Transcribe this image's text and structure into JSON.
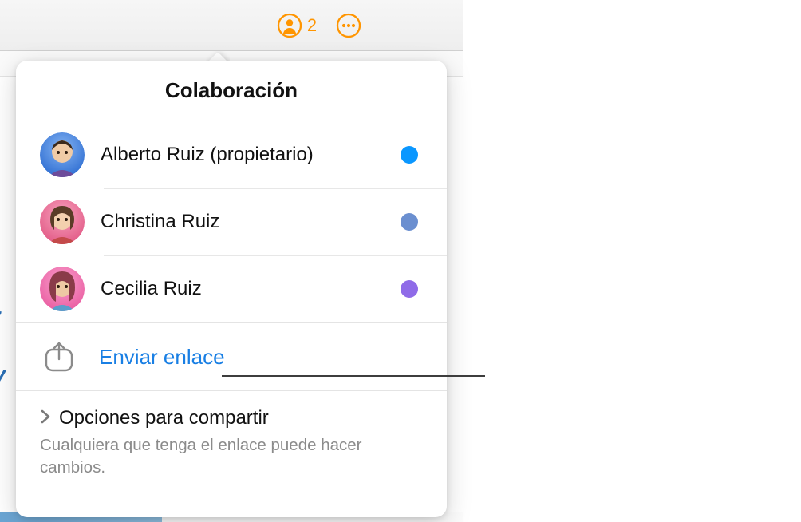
{
  "toolbar": {
    "collaborator_count": "2"
  },
  "popover": {
    "title": "Colaboración",
    "participants": [
      {
        "name": "Alberto Ruiz (propietario)",
        "color": "#0a97ff",
        "avatar_bg1": "#5a9bf0",
        "avatar_bg2": "#2b6bd1"
      },
      {
        "name": "Christina Ruiz",
        "color": "#6b8fd0",
        "avatar_bg1": "#f07da2",
        "avatar_bg2": "#e15784"
      },
      {
        "name": "Cecilia Ruiz",
        "color": "#8f6be8",
        "avatar_bg1": "#f379b5",
        "avatar_bg2": "#e95a9f"
      }
    ],
    "send_link_label": "Enviar enlace",
    "share_options": {
      "title": "Opciones para compartir",
      "subtitle": "Cualquiera que tenga el enlace puede hacer cambios."
    }
  }
}
